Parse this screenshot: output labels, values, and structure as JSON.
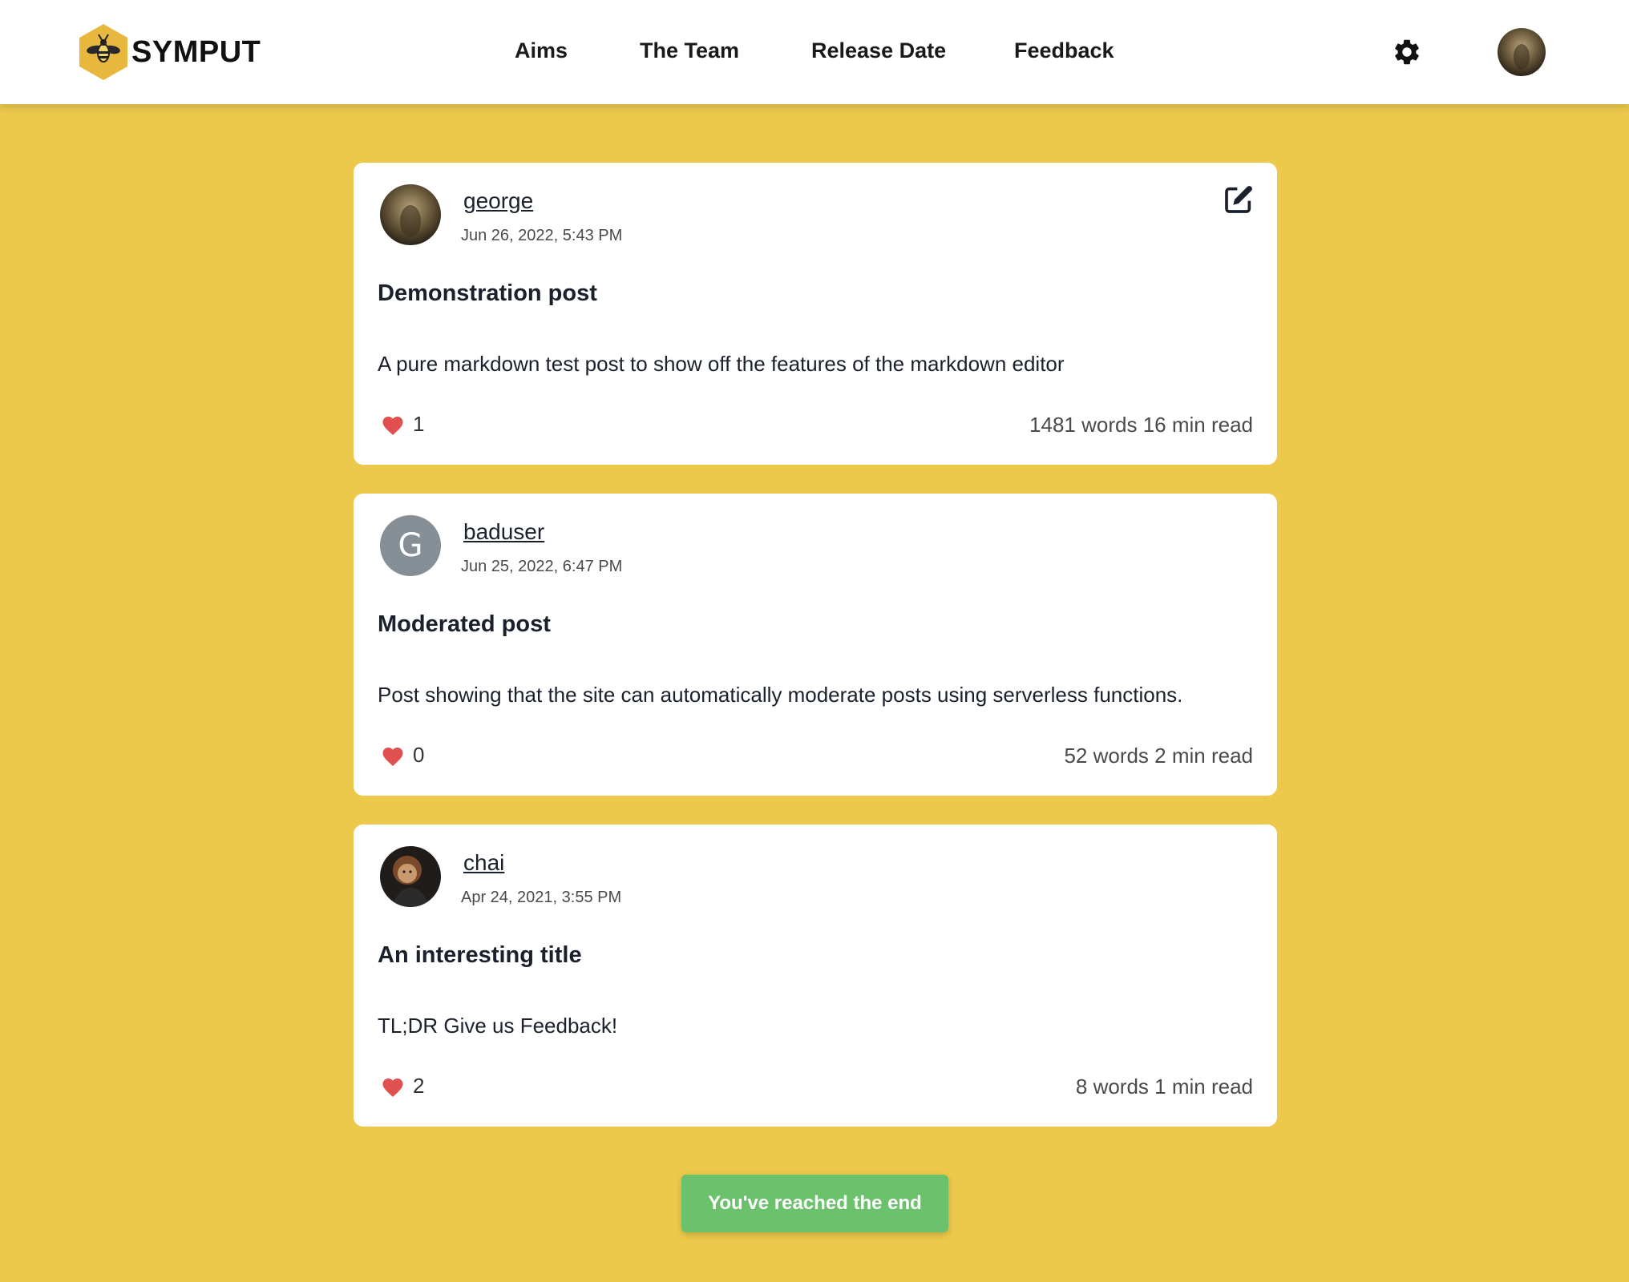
{
  "brand": {
    "name": "SYMPUT",
    "logo_icon": "bee-hexagon-icon",
    "accent": "#ecc94b"
  },
  "nav": {
    "links": [
      {
        "label": "Aims"
      },
      {
        "label": "The Team"
      },
      {
        "label": "Release Date"
      },
      {
        "label": "Feedback"
      }
    ],
    "settings_icon": "gear-icon",
    "profile_icon": "user-avatar"
  },
  "posts": [
    {
      "author": "george",
      "avatar": "photo",
      "date": "Jun 26, 2022, 5:43 PM",
      "title": "Demonstration post",
      "excerpt": "A pure markdown test post to show off the features of the markdown editor",
      "likes": "1",
      "stats": "1481 words 16 min read",
      "editable": true
    },
    {
      "author": "baduser",
      "avatar_letter": "G",
      "date": "Jun 25, 2022, 6:47 PM",
      "title": "Moderated post",
      "excerpt": "Post showing that the site can automatically moderate posts using serverless functions.",
      "likes": "0",
      "stats": "52 words 2 min read",
      "editable": false
    },
    {
      "author": "chai",
      "avatar": "photo",
      "date": "Apr 24, 2021, 3:55 PM",
      "title": "An interesting title",
      "excerpt": "TL;DR Give us Feedback!",
      "likes": "2",
      "stats": "8 words 1 min read",
      "editable": false
    }
  ],
  "end_button": {
    "label": "You've reached the end",
    "color": "#6cc16d"
  },
  "colors": {
    "background": "#ecc94b",
    "heart": "#e05050",
    "card": "#ffffff"
  }
}
